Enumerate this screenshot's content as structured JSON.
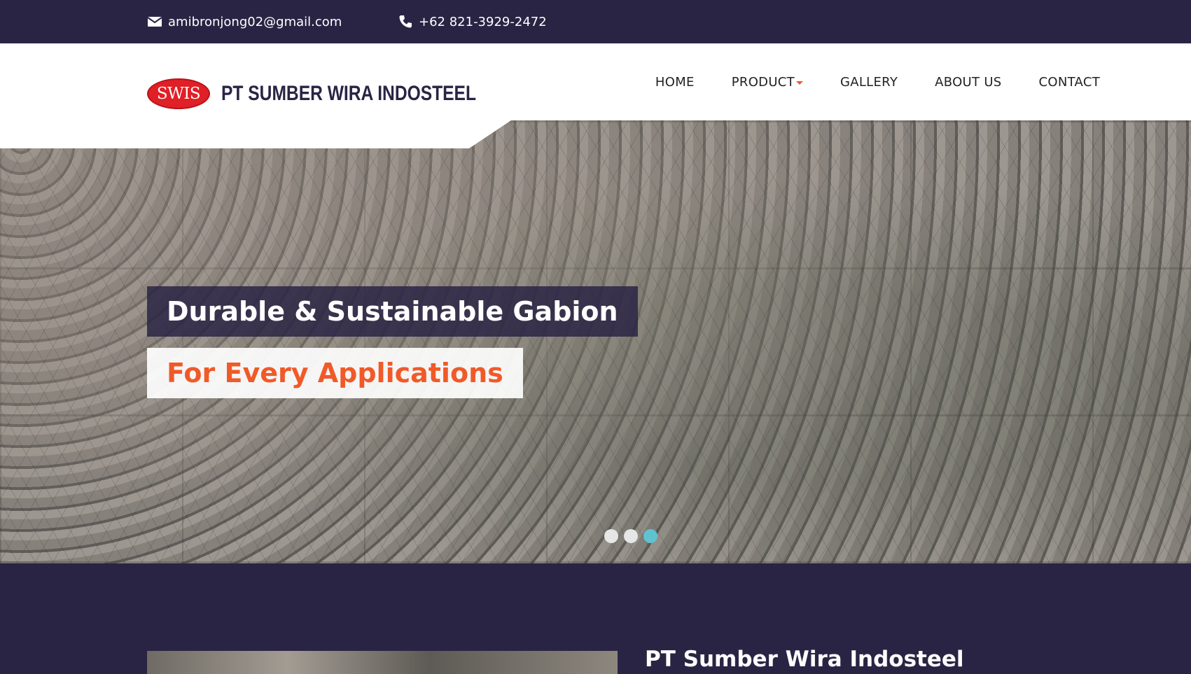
{
  "topbar": {
    "email": "amibronjong02@gmail.com",
    "phone": "+62 821-3929-2472",
    "email_icon": "envelope-icon",
    "phone_icon": "phone-icon"
  },
  "brand": {
    "badge": "SWIS",
    "name": "PT SUMBER WIRA INDOSTEEL",
    "badge_color": "#e01f26"
  },
  "nav": {
    "items": [
      {
        "label": "HOME"
      },
      {
        "label": "PRODUCT",
        "has_dropdown": true
      },
      {
        "label": "GALLERY"
      },
      {
        "label": "ABOUT US"
      },
      {
        "label": "CONTACT"
      }
    ]
  },
  "hero": {
    "title": "Durable & Sustainable Gabion",
    "subtitle": "For Every Applications",
    "slide_count": 3,
    "active_slide": 3
  },
  "about": {
    "title": "PT Sumber Wira Indosteel"
  },
  "colors": {
    "primary_dark": "#2a2444",
    "accent_orange": "#f05a28",
    "dot_active": "#5fc3cf"
  }
}
